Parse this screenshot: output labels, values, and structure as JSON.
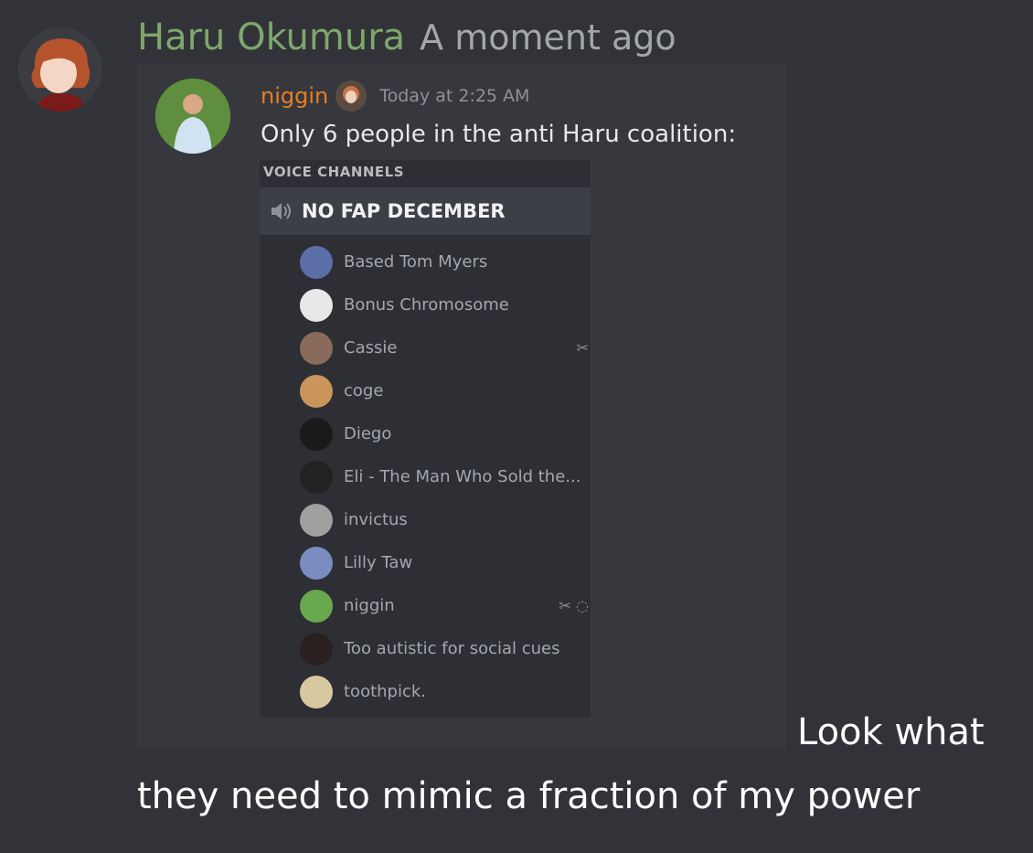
{
  "message": {
    "author": "Haru Okumura",
    "timestamp": "A moment ago",
    "text_trailing": "Look what",
    "text_line2": "they need to mimic a fraction of my power"
  },
  "embed": {
    "author": "niggin",
    "timestamp": "Today at 2:25 AM",
    "text": "Only 6 people in the anti Haru coalition:",
    "section_label": "VOICE CHANNELS",
    "channel_name": "NO FAP DECEMBER",
    "users": [
      {
        "name": "Based Tom Myers",
        "icons": "",
        "color": "#5b6ea8"
      },
      {
        "name": "Bonus Chromosome",
        "icons": "",
        "color": "#e8e8e8"
      },
      {
        "name": "Cassie",
        "icons": "✂",
        "color": "#8a6a5a"
      },
      {
        "name": "coge",
        "icons": "",
        "color": "#c9955a"
      },
      {
        "name": "Diego",
        "icons": "",
        "color": "#1a1a1a"
      },
      {
        "name": "Eli - The Man Who Sold the...",
        "icons": "",
        "color": "#222222"
      },
      {
        "name": "invictus",
        "icons": "",
        "color": "#a0a0a0"
      },
      {
        "name": "Lilly Taw",
        "icons": "",
        "color": "#7a8cc0"
      },
      {
        "name": "niggin",
        "icons": "✂ ◌",
        "color": "#6aa84f"
      },
      {
        "name": "Too autistic for social cues",
        "icons": "",
        "color": "#2b2020"
      },
      {
        "name": "toothpick.",
        "icons": "",
        "color": "#d8c8a0"
      }
    ]
  }
}
